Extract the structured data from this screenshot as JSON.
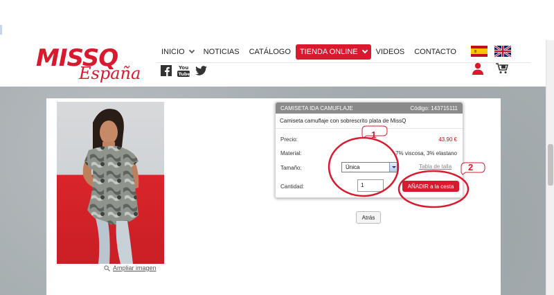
{
  "header": {
    "logo_main": "MISSQ",
    "logo_sub": "España"
  },
  "nav": {
    "items": [
      {
        "label": "INICIO",
        "has_dropdown": true
      },
      {
        "label": "NOTICIAS"
      },
      {
        "label": "CATÁLOGO"
      },
      {
        "label": "TIENDA ONLINE",
        "has_dropdown": true,
        "active": true
      },
      {
        "label": "VIDEOS"
      },
      {
        "label": "CONTACTO"
      }
    ],
    "social": [
      "facebook-icon",
      "youtube-icon",
      "twitter-icon"
    ],
    "youtube_you": "You",
    "youtube_tube": "Tube"
  },
  "languages": [
    "spain-flag-icon",
    "uk-flag-icon"
  ],
  "product": {
    "title": "CAMISETA IDA CAMUFLAJE",
    "code_label": "Código: 143715111",
    "description": "Camiseta camuflaje con sobrescrito plata de MissQ",
    "price_label": "Precio:",
    "price_value": "43.90 €",
    "material_label": "Material:",
    "material_value": "7% viscosa, 3% elastano",
    "size_label": "Tamaño:",
    "size_value": "Única",
    "size_table_link": "Tabla de talla",
    "quantity_label": "Cantidad:",
    "quantity_value": "1",
    "add_button": "AÑADIR a la cesta"
  },
  "enlarge_label": "Ampliar imagen",
  "back_button": "Atrás",
  "annotations": {
    "one": "1",
    "two": "2"
  },
  "colors": {
    "brand": "#d8192e",
    "panel_header": "#8a8a8a",
    "price": "#b3101c"
  }
}
